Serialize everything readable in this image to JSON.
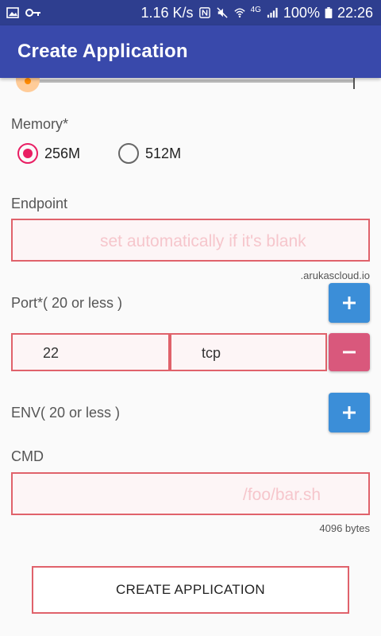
{
  "status_bar": {
    "speed": "1.16 K/s",
    "network": "4G",
    "battery": "100%",
    "time": "22:26"
  },
  "app_bar": {
    "title": "Create Application"
  },
  "memory": {
    "label": "Memory*",
    "options": [
      {
        "label": "256M",
        "selected": true
      },
      {
        "label": "512M",
        "selected": false
      }
    ]
  },
  "endpoint": {
    "label": "Endpoint",
    "placeholder": "set automatically if it's blank",
    "suffix": ".arukascloud.io"
  },
  "port": {
    "label": "Port*( 20 or less )",
    "number": "22",
    "protocol": "tcp"
  },
  "env": {
    "label": "ENV( 20 or less )"
  },
  "cmd": {
    "label": "CMD",
    "placeholder": "/foo/bar.sh",
    "hint": "4096 bytes"
  },
  "create_button": {
    "label": "CREATE APPLICATION"
  },
  "colors": {
    "status_bar": "#2e3e8f",
    "app_bar": "#3949ab",
    "accent": "#e91e63",
    "add_button": "#3b8ed8",
    "remove_button": "#d9587c",
    "field_border": "#e0626b"
  }
}
